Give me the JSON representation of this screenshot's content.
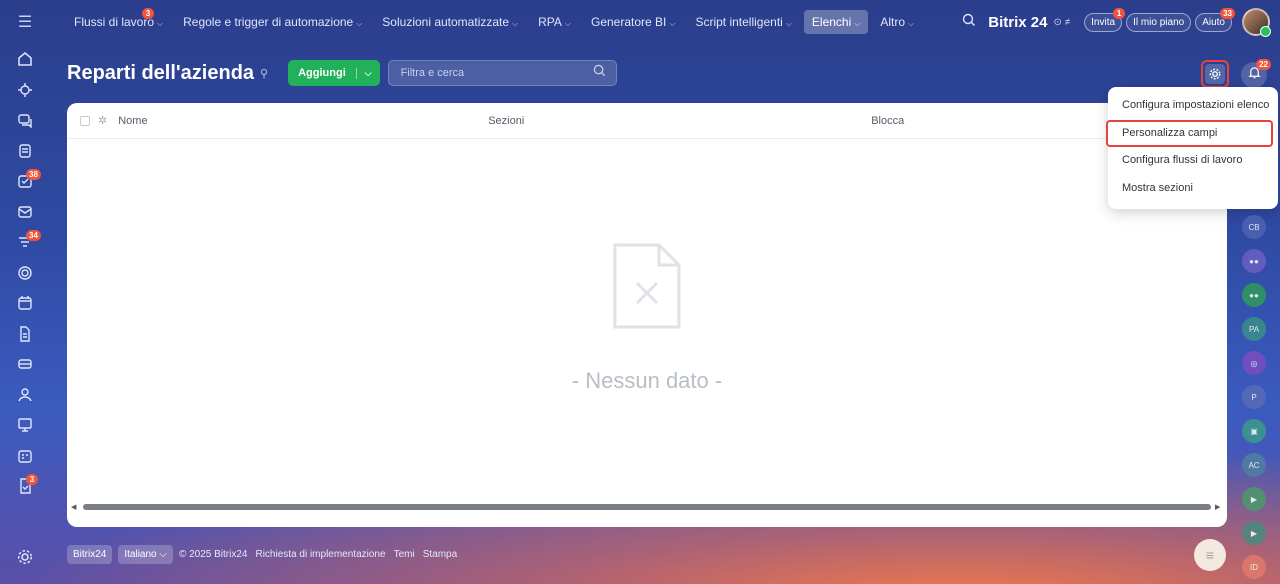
{
  "topnav": {
    "items": [
      {
        "label": "Flussi di lavoro",
        "badge": "3",
        "active": false
      },
      {
        "label": "Regole e trigger di automazione",
        "badge": "",
        "active": false
      },
      {
        "label": "Soluzioni automatizzate",
        "badge": "",
        "active": false
      },
      {
        "label": "RPA",
        "badge": "",
        "active": false
      },
      {
        "label": "Generatore BI",
        "badge": "",
        "active": false
      },
      {
        "label": "Script intelligenti",
        "badge": "",
        "active": false
      },
      {
        "label": "Elenchi",
        "badge": "",
        "active": true
      },
      {
        "label": "Altro",
        "badge": "",
        "active": false
      }
    ],
    "brand": "Bitrix 24",
    "invite": {
      "label": "Invita",
      "badge": "1"
    },
    "plan": "Il mio piano",
    "help": {
      "label": "Aiuto",
      "badge": "33"
    }
  },
  "sidebar": {
    "badges": {
      "tasks": "38",
      "feed": "34",
      "approvals": "3"
    }
  },
  "header": {
    "title": "Reparti dell'azienda",
    "add_label": "Aggiungi",
    "search_placeholder": "Filtra e cerca",
    "notifications_badge": "22"
  },
  "table": {
    "columns": [
      "Nome",
      "Sezioni",
      "Blocca"
    ],
    "empty_message": "- Nessun dato -"
  },
  "settings_menu": {
    "items": [
      {
        "label": "Configura impostazioni elenco",
        "highlighted": false
      },
      {
        "label": "Personalizza campi",
        "highlighted": true
      },
      {
        "label": "Configura flussi di lavoro",
        "highlighted": false
      },
      {
        "label": "Mostra sezioni",
        "highlighted": false
      }
    ]
  },
  "right_rail": {
    "avatars": [
      "CB",
      "",
      "",
      "PA",
      "",
      "P",
      "",
      "AC",
      "",
      "",
      "ID"
    ]
  },
  "footer": {
    "brand": "Bitrix24",
    "language": "Italiano",
    "copyright": "© 2025 Bitrix24",
    "links": [
      "Richiesta di implementazione",
      "Temi",
      "Stampa"
    ]
  },
  "colors": {
    "accent_green": "#20b15a",
    "highlight_red": "#e6443a",
    "badge_red": "#f0543c"
  }
}
